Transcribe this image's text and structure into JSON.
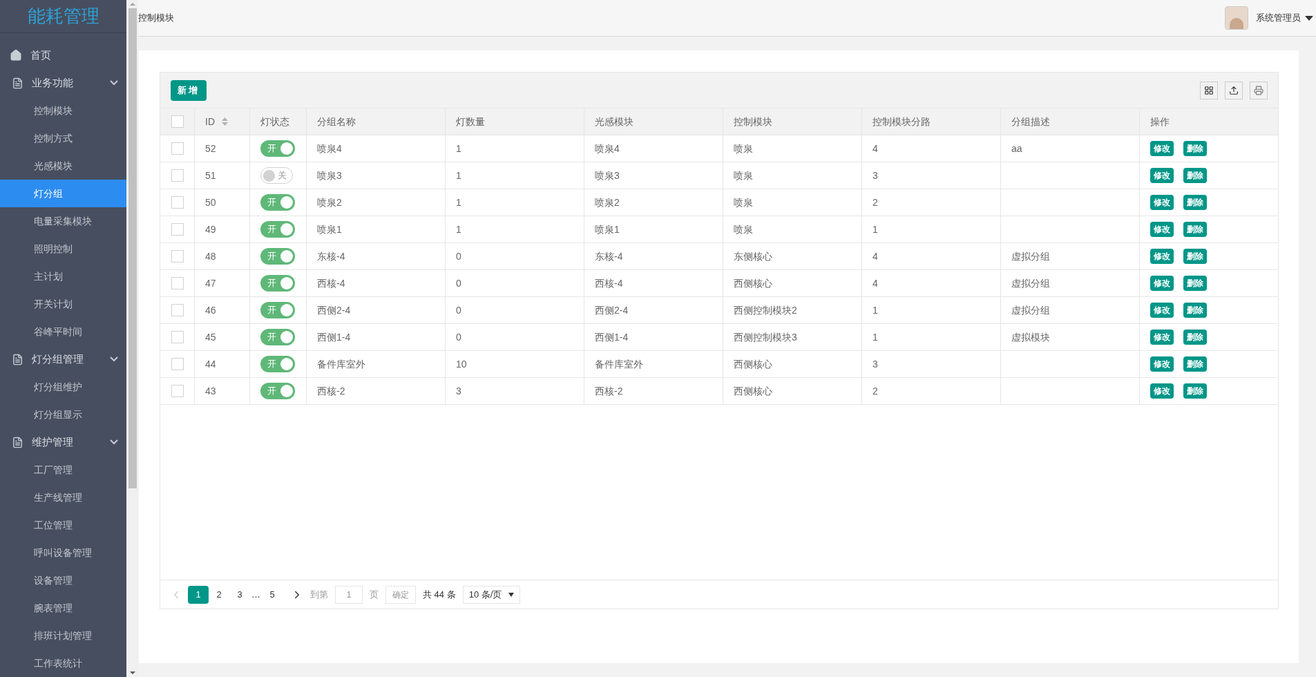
{
  "app_title": "能耗管理",
  "sidebar": [
    {
      "label": "首页",
      "kind": "link"
    },
    {
      "label": "业务功能",
      "kind": "section",
      "expanded": true,
      "children": [
        {
          "label": "控制模块",
          "selected": false
        },
        {
          "label": "控制方式",
          "selected": false
        },
        {
          "label": "光感模块",
          "selected": false
        },
        {
          "label": "灯分组",
          "selected": true
        },
        {
          "label": "电量采集模块",
          "selected": false
        },
        {
          "label": "照明控制",
          "selected": false
        },
        {
          "label": "主计划",
          "selected": false
        },
        {
          "label": "开关计划",
          "selected": false
        },
        {
          "label": "谷峰平时间",
          "selected": false
        }
      ]
    },
    {
      "label": "灯分组管理",
      "kind": "section",
      "expanded": true,
      "children": [
        {
          "label": "灯分组维护",
          "selected": false
        },
        {
          "label": "灯分组显示",
          "selected": false
        }
      ]
    },
    {
      "label": "维护管理",
      "kind": "section",
      "expanded": true,
      "children": [
        {
          "label": "工厂管理",
          "selected": false
        },
        {
          "label": "生产线管理",
          "selected": false
        },
        {
          "label": "工位管理",
          "selected": false
        },
        {
          "label": "呼叫设备管理",
          "selected": false
        },
        {
          "label": "设备管理",
          "selected": false
        },
        {
          "label": "腕表管理",
          "selected": false
        },
        {
          "label": "排班计划管理",
          "selected": false
        },
        {
          "label": "工作表统计",
          "selected": false
        }
      ]
    }
  ],
  "breadcrumb": "控制模块",
  "user": {
    "name": "系统管理员"
  },
  "toolbar": {
    "add_button": "新增"
  },
  "table": {
    "all_checked": false,
    "columns": [
      "ID",
      "灯状态",
      "分组名称",
      "灯数量",
      "光感模块",
      "控制模块",
      "控制模块分路",
      "分组描述",
      "操作"
    ],
    "rows": [
      {
        "checked": false,
        "id": "52",
        "on": true,
        "switch_label": "开",
        "name": "喷泉4",
        "count": "1",
        "sensor": "喷泉4",
        "module": "喷泉",
        "route": "4",
        "desc": "aa",
        "actions": [
          "修改",
          "删除"
        ]
      },
      {
        "checked": false,
        "id": "51",
        "on": false,
        "switch_label": "关",
        "name": "喷泉3",
        "count": "1",
        "sensor": "喷泉3",
        "module": "喷泉",
        "route": "3",
        "desc": "",
        "actions": [
          "修改",
          "删除"
        ]
      },
      {
        "checked": false,
        "id": "50",
        "on": true,
        "switch_label": "开",
        "name": "喷泉2",
        "count": "1",
        "sensor": "喷泉2",
        "module": "喷泉",
        "route": "2",
        "desc": "",
        "actions": [
          "修改",
          "删除"
        ]
      },
      {
        "checked": false,
        "id": "49",
        "on": true,
        "switch_label": "开",
        "name": "喷泉1",
        "count": "1",
        "sensor": "喷泉1",
        "module": "喷泉",
        "route": "1",
        "desc": "",
        "actions": [
          "修改",
          "删除"
        ]
      },
      {
        "checked": false,
        "id": "48",
        "on": true,
        "switch_label": "开",
        "name": "东核-4",
        "count": "0",
        "sensor": "东核-4",
        "module": "东侧核心",
        "route": "4",
        "desc": "虚拟分组",
        "actions": [
          "修改",
          "删除"
        ]
      },
      {
        "checked": false,
        "id": "47",
        "on": true,
        "switch_label": "开",
        "name": "西核-4",
        "count": "0",
        "sensor": "西核-4",
        "module": "西侧核心",
        "route": "4",
        "desc": "虚拟分组",
        "actions": [
          "修改",
          "删除"
        ]
      },
      {
        "checked": false,
        "id": "46",
        "on": true,
        "switch_label": "开",
        "name": "西侧2-4",
        "count": "0",
        "sensor": "西侧2-4",
        "module": "西侧控制模块2",
        "route": "1",
        "desc": "虚拟分组",
        "actions": [
          "修改",
          "删除"
        ]
      },
      {
        "checked": false,
        "id": "45",
        "on": true,
        "switch_label": "开",
        "name": "西侧1-4",
        "count": "0",
        "sensor": "西侧1-4",
        "module": "西侧控制模块3",
        "route": "1",
        "desc": "虚拟模块",
        "actions": [
          "修改",
          "删除"
        ]
      },
      {
        "checked": false,
        "id": "44",
        "on": true,
        "switch_label": "开",
        "name": "备件库室外",
        "count": "10",
        "sensor": "备件库室外",
        "module": "西侧核心",
        "route": "3",
        "desc": "",
        "actions": [
          "修改",
          "删除"
        ]
      },
      {
        "checked": false,
        "id": "43",
        "on": true,
        "switch_label": "开",
        "name": "西核-2",
        "count": "3",
        "sensor": "西核-2",
        "module": "西侧核心",
        "route": "2",
        "desc": "",
        "actions": [
          "修改",
          "删除"
        ]
      }
    ]
  },
  "pagination": {
    "pages": [
      {
        "label": "1",
        "selected": true
      },
      {
        "label": "2",
        "selected": false
      },
      {
        "label": "3",
        "selected": false
      },
      {
        "label": "…",
        "kind": "ellipsis"
      },
      {
        "label": "5",
        "selected": false
      }
    ],
    "goto_label": "到第",
    "goto_value": "1",
    "page_unit": "页",
    "confirm": "确定",
    "total": "共 44 条",
    "page_size": "10 条/页"
  }
}
